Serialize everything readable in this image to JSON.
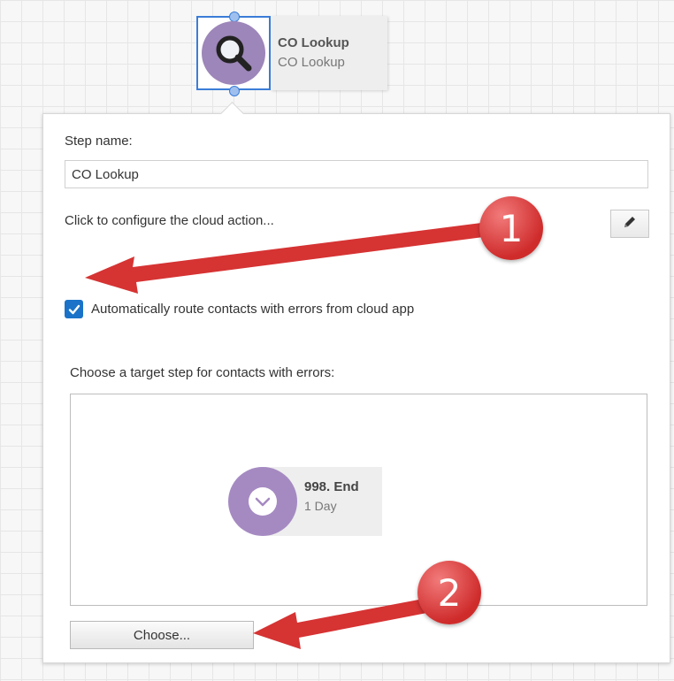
{
  "node": {
    "title": "CO Lookup",
    "subtitle": "CO Lookup",
    "icon": "magnifier-icon"
  },
  "panel": {
    "step_name_label": "Step name:",
    "step_name_value": "CO Lookup",
    "configure_text": "Click to configure the cloud action...",
    "edit_icon": "pencil-icon",
    "auto_route_checked": true,
    "auto_route_label": "Automatically route contacts with errors from cloud app",
    "target_label": "Choose a target step for contacts with errors:",
    "target_node": {
      "title": "998. End",
      "subtitle": "1 Day",
      "icon": "chevron-down-icon"
    },
    "choose_button": "Choose..."
  },
  "annotations": {
    "badge_1": "1",
    "badge_2": "2",
    "color": "#d63333"
  }
}
